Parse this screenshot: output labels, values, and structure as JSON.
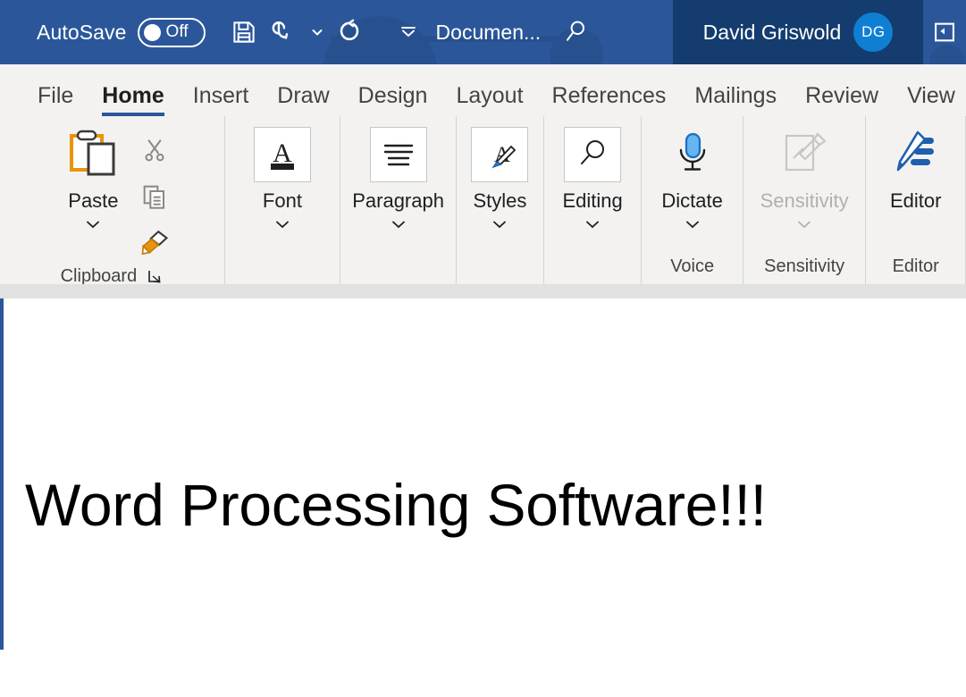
{
  "titlebar": {
    "autosave_label": "AutoSave",
    "autosave_state": "Off",
    "document_title": "Documen...",
    "account_name": "David Griswold",
    "account_initials": "DG",
    "save_icon": "save-floppy-icon",
    "undo_icon": "undo-arrow-icon",
    "redo_icon": "redo-arrow-icon",
    "search_icon": "search-magnifier-icon",
    "customize_qat_icon": "customize-quick-access-toolbar-icon",
    "ribbon_display_icon": "ribbon-display-options-icon",
    "bg_color": "#2B579A",
    "account_bg_color": "#143C6E",
    "avatar_color": "#0F7FD4"
  },
  "tabs": [
    {
      "label": "File",
      "active": false
    },
    {
      "label": "Home",
      "active": true
    },
    {
      "label": "Insert",
      "active": false
    },
    {
      "label": "Draw",
      "active": false
    },
    {
      "label": "Design",
      "active": false
    },
    {
      "label": "Layout",
      "active": false
    },
    {
      "label": "References",
      "active": false
    },
    {
      "label": "Mailings",
      "active": false
    },
    {
      "label": "Review",
      "active": false
    },
    {
      "label": "View",
      "active": false
    }
  ],
  "active_tab_underline_color": "#2B579A",
  "ribbon": {
    "groups": [
      {
        "name": "clipboard",
        "footer_label": "Clipboard",
        "has_dialog_launcher": true,
        "big_button": {
          "label": "Paste",
          "icon": "paste-clipboard-icon",
          "has_chevron": true,
          "disabled": false
        },
        "small_buttons": [
          {
            "label": "Cut",
            "icon": "cut-scissors-icon"
          },
          {
            "label": "Copy",
            "icon": "copy-documents-icon"
          },
          {
            "label": "Format Painter",
            "icon": "format-painter-brush-icon"
          }
        ]
      },
      {
        "name": "font",
        "footer_label": "",
        "has_dialog_launcher": false,
        "big_button": {
          "label": "Font",
          "icon": "font-a-underline-icon",
          "has_chevron": true,
          "disabled": false
        },
        "small_buttons": []
      },
      {
        "name": "paragraph",
        "footer_label": "",
        "has_dialog_launcher": false,
        "big_button": {
          "label": "Paragraph",
          "icon": "paragraph-align-lines-icon",
          "has_chevron": true,
          "disabled": false
        },
        "small_buttons": []
      },
      {
        "name": "styles",
        "footer_label": "",
        "has_dialog_launcher": false,
        "big_button": {
          "label": "Styles",
          "icon": "styles-a-brush-icon",
          "has_chevron": true,
          "disabled": false
        },
        "small_buttons": []
      },
      {
        "name": "editing",
        "footer_label": "",
        "has_dialog_launcher": false,
        "big_button": {
          "label": "Editing",
          "icon": "editing-magnifier-icon",
          "has_chevron": true,
          "disabled": false
        },
        "small_buttons": []
      },
      {
        "name": "voice",
        "footer_label": "Voice",
        "has_dialog_launcher": false,
        "big_button": {
          "label": "Dictate",
          "icon": "dictate-microphone-icon",
          "has_chevron": true,
          "disabled": false
        },
        "small_buttons": []
      },
      {
        "name": "sensitivity",
        "footer_label": "Sensitivity",
        "has_dialog_launcher": false,
        "big_button": {
          "label": "Sensitivity",
          "icon": "sensitivity-label-tag-icon",
          "has_chevron": true,
          "disabled": true
        },
        "small_buttons": []
      },
      {
        "name": "editor",
        "footer_label": "Editor",
        "has_dialog_launcher": false,
        "big_button": {
          "label": "Editor",
          "icon": "editor-pen-lines-icon",
          "has_chevron": false,
          "disabled": false
        },
        "small_buttons": []
      }
    ]
  },
  "document": {
    "body_text": "Word Processing Software!!!",
    "page_background": "#FFFFFF",
    "left_rail_color": "#2B579A"
  }
}
